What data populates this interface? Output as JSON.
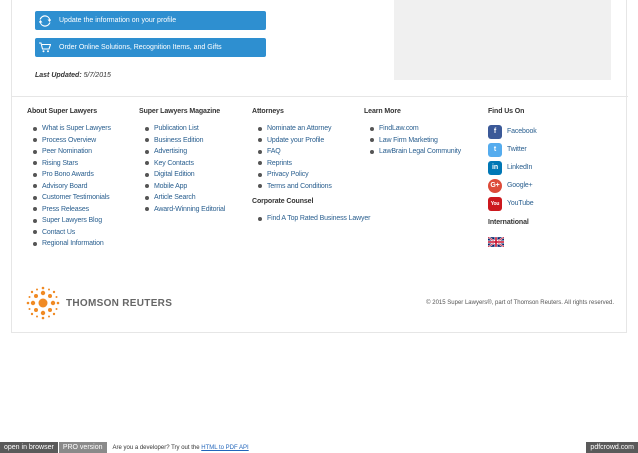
{
  "top": {
    "update_label": "Update the information on your profile",
    "order_label": "Order Online Solutions, Recognition Items, and Gifts",
    "last_updated_label": "Last Updated:",
    "last_updated_value": "5/7/2015"
  },
  "footer": {
    "about": {
      "heading": "About Super Lawyers",
      "items": [
        "What is Super Lawyers",
        "Process Overview",
        "Peer Nomination",
        "Rising Stars",
        "Pro Bono Awards",
        "Advisory Board",
        "Customer Testimonials",
        "Press Releases",
        "Super Lawyers Blog",
        "Contact Us",
        "Regional Information"
      ]
    },
    "magazine": {
      "heading": "Super Lawyers Magazine",
      "items": [
        "Publication List",
        "Business Edition",
        "Advertising",
        "Key Contacts",
        "Digital Edition",
        "Mobile App",
        "Article Search",
        "Award-Winning Editorial"
      ]
    },
    "attorneys": {
      "heading": "Attorneys",
      "items": [
        "Nominate an Attorney",
        "Update your Profile",
        "FAQ",
        "Reprints",
        "Privacy Policy",
        "Terms and Conditions"
      ]
    },
    "corporate": {
      "heading": "Corporate Counsel",
      "items": [
        "Find A Top Rated Business Lawyer"
      ]
    },
    "learn": {
      "heading": "Learn More",
      "items": [
        "FindLaw.com",
        "Law Firm Marketing",
        "LawBrain Legal Community"
      ]
    },
    "find": {
      "heading": "Find Us On",
      "items": [
        {
          "label": "Facebook",
          "icon": "facebook-icon",
          "color": "#3b5998",
          "glyph": "f"
        },
        {
          "label": "Twitter",
          "icon": "twitter-icon",
          "color": "#55acee",
          "glyph": "t"
        },
        {
          "label": "LinkedIn",
          "icon": "linkedin-icon",
          "color": "#0077b5",
          "glyph": "in"
        },
        {
          "label": "Google+",
          "icon": "google-plus-icon",
          "color": "#dd4b39",
          "glyph": "G+"
        },
        {
          "label": "YouTube",
          "icon": "youtube-icon",
          "color": "#cc181e",
          "glyph": "You"
        }
      ]
    },
    "international": {
      "heading": "International"
    }
  },
  "bottom": {
    "logo_text": "THOMSON REUTERS",
    "copyright": "© 2015 Super Lawyers®, part of Thomson Reuters. All rights reserved."
  },
  "pdfbar": {
    "open": "open in browser",
    "pro": "PRO version",
    "dev_text": "Are you a developer? Try out the",
    "dev_link": "HTML to PDF API",
    "brand": "pdfcrowd.com"
  },
  "colors": {
    "button_blue": "#2e8fd0",
    "link_blue": "#2a5f8f"
  }
}
